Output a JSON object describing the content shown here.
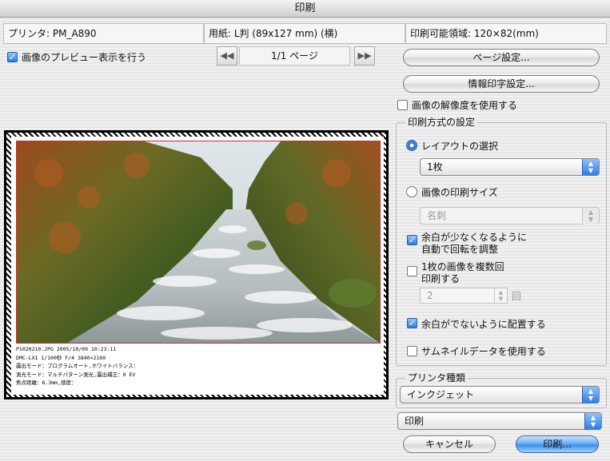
{
  "window": {
    "title": "印刷"
  },
  "info": {
    "printer": "プリンタ: PM_A890",
    "paper": "用紙: L判 (89x127 mm) (横)",
    "printable": "印刷可能領域: 120×82(mm)"
  },
  "preview_toggle": {
    "label": "画像のプレビュー表示を行う",
    "checked": true
  },
  "pager": {
    "prev": "◀◀",
    "next": "▶▶",
    "page": "1/1 ページ"
  },
  "buttons": {
    "page_setup": "ページ設定...",
    "info_print": "情報印字設定...",
    "cancel": "キャンセル",
    "print": "印刷..."
  },
  "use_resolution": {
    "label": "画像の解像度を使用する",
    "checked": false
  },
  "print_method": {
    "title": "印刷方式の設定",
    "layout_radio": {
      "label": "レイアウトの選択",
      "selected": true
    },
    "layout_popup": "1枚",
    "size_radio": {
      "label": "画像の印刷サイズ",
      "selected": false
    },
    "size_popup": "名刺",
    "auto_rotate": {
      "line1": "余白が少なくなるように",
      "line2": "自動で回転を調整",
      "checked": true
    },
    "multi_copy": {
      "line1": "1枚の画像を複数回",
      "line2": "印刷する",
      "checked": false
    },
    "copies": {
      "value": "2",
      "unit": "回"
    },
    "no_margin": {
      "label": "余白がでないように配置する",
      "checked": true
    },
    "thumbnail": {
      "label": "サムネイルデータを使用する",
      "checked": false
    }
  },
  "printer_type": {
    "title": "プリンタ種類",
    "value": "インクジェット"
  },
  "print_mode": {
    "value": "印刷"
  },
  "preview": {
    "meta_lines": [
      "P1020210.JPG 2005/10/09 10:23:11",
      "DMC-LX1 1/100秒 F/4 3840×2160",
      "露出モード：プログラムオート,ホワイトバランス：",
      "測光モード：マルチパターン測光,露出補正：0 EV",
      "焦点距離：6.3mm,感度："
    ]
  }
}
